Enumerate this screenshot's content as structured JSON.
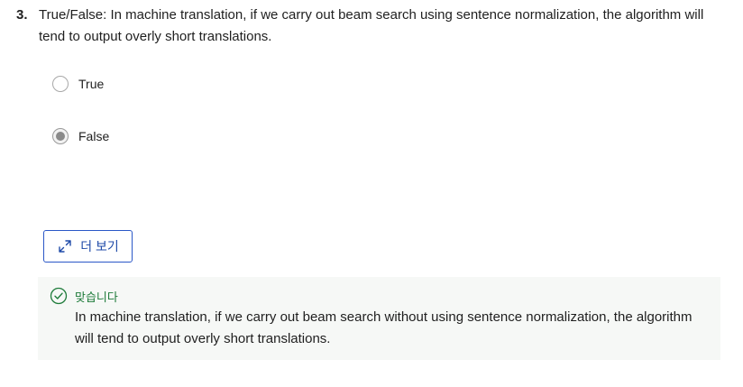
{
  "question": {
    "number": "3.",
    "text": "True/False: In machine translation, if we carry out beam search using sentence normalization, the algorithm will tend to output overly short translations."
  },
  "options": [
    {
      "label": "True",
      "selected": false
    },
    {
      "label": "False",
      "selected": true
    }
  ],
  "more_button": {
    "label": "더 보기",
    "icon": "expand-icon"
  },
  "feedback": {
    "status_label": "맞습니다",
    "status_icon": "check-circle-icon",
    "explanation": "In machine translation, if we carry out beam search without using sentence normalization, the algorithm will tend to output overly short translations."
  },
  "colors": {
    "accent": "#2a57c7",
    "correct": "#1e7b3a",
    "feedback_bg": "#f6f8f6"
  }
}
